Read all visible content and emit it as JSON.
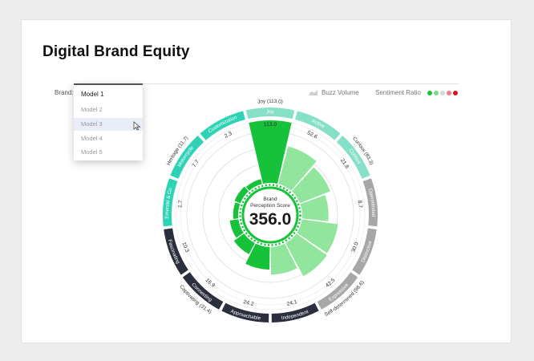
{
  "page": {
    "title": "Digital Brand Equity"
  },
  "filters": {
    "brand_label": "Brand:",
    "dropdown": {
      "selected": "Model 1",
      "options": [
        "Model 2",
        "Model 3",
        "Model 4",
        "Model 5"
      ],
      "highlighted_index": 1
    }
  },
  "legend": {
    "buzz_label": "Buzz Volume",
    "sentiment_label": "Sentiment Ratio",
    "sentiment_colors": [
      "#19c23a",
      "#7fd98a",
      "#d6d6d6",
      "#ef7f84",
      "#e3101a"
    ]
  },
  "center": {
    "label_line1": "Brand",
    "label_line2": "Perception Score",
    "score": "356.0"
  },
  "chart_data": {
    "type": "polar-bar",
    "center_score": 356.0,
    "segments": [
      {
        "label": "Joy",
        "value": 113.0,
        "value_label": "113.0",
        "group": "Joy (113.0)",
        "color": "#86e0c8",
        "bar": 1.0,
        "bar_color": "#16c23a"
      },
      {
        "label": "Active",
        "value": 52.6,
        "value_label": "52.6",
        "group": "",
        "color": "#86e0c8",
        "bar": 0.62,
        "bar_color": "#7fe08c"
      },
      {
        "label": "Curious",
        "value": 21.8,
        "value_label": "21.8",
        "group": "Curious (83.3)",
        "color": "#86e0c8",
        "bar": 0.52,
        "bar_color": "#7fe08c"
      },
      {
        "label": "Openminded",
        "value": 8.7,
        "value_label": "8.7",
        "group": "",
        "color": "#a7a7a7",
        "bar": 0.42,
        "bar_color": "#7fe08c"
      },
      {
        "label": "Distinctive",
        "value": 30.0,
        "value_label": "30.0",
        "group": "",
        "color": "#a7a7a7",
        "bar": 0.58,
        "bar_color": "#7fe08c"
      },
      {
        "label": "Expressive",
        "value": 42.5,
        "value_label": "42.5",
        "group": "Self-determined (96.6)",
        "color": "#a7a7a7",
        "bar": 0.6,
        "bar_color": "#7fe08c"
      },
      {
        "label": "Independent",
        "value": 24.1,
        "value_label": "24.1",
        "group": "",
        "color": "#2b2f3d",
        "bar": 0.44,
        "bar_color": "#7fe08c"
      },
      {
        "label": "Approachable",
        "value": 24.2,
        "value_label": "24.2",
        "group": "",
        "color": "#2b2f3d",
        "bar": 0.36,
        "bar_color": "#16c23a"
      },
      {
        "label": "Connecting",
        "value": 16.9,
        "value_label": "16.9",
        "group": "Captivating (31.4)",
        "color": "#2b2f3d",
        "bar": 0.2,
        "bar_color": "#16c23a"
      },
      {
        "label": "Fascinating",
        "value": 10.3,
        "value_label": "10.3",
        "group": "",
        "color": "#2b2f3d",
        "bar": 0.14,
        "bar_color": "#16c23a"
      },
      {
        "label": "Emerald & Co.",
        "value": 1.7,
        "value_label": "1.7",
        "group": "",
        "color": "#2ed3b5",
        "bar": 0.08,
        "bar_color": "#16c23a"
      },
      {
        "label": "Motorcycle",
        "value": 7.7,
        "value_label": "7.7",
        "group": "Heritage (11.7)",
        "color": "#2ed3b5",
        "bar": 0.1,
        "bar_color": "#16c23a"
      },
      {
        "label": "Customization",
        "value": 2.3,
        "value_label": "2.3",
        "group": "",
        "color": "#2ed3b5",
        "bar": 0.08,
        "bar_color": "#16c23a"
      }
    ]
  }
}
